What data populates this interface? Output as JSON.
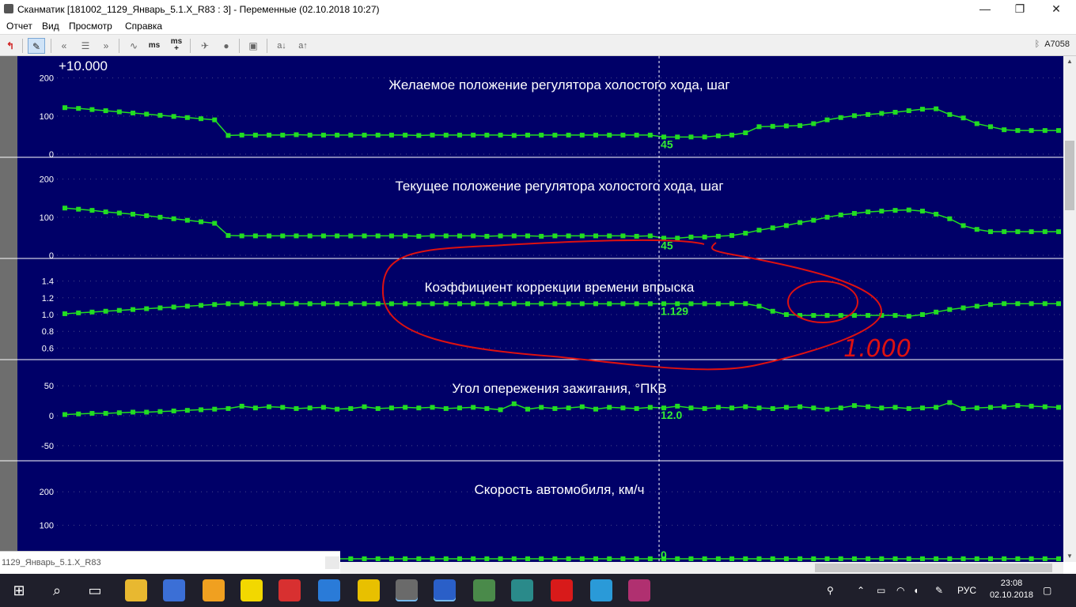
{
  "window": {
    "title": "Сканматик [181002_1129_Январь_5.1.X_R83 : 3] - Переменные (02.10.2018  10:27)",
    "minimize_glyph": "—",
    "maximize_glyph": "❐",
    "close_glyph": "✕"
  },
  "menu": {
    "items": [
      {
        "label": "Отчет"
      },
      {
        "label": "Вид"
      },
      {
        "label": "Просмотр"
      },
      {
        "label": "Справка"
      }
    ]
  },
  "toolbar": {
    "icons": [
      "exit-icon",
      "edit-icon",
      "prev-icon",
      "list-icon",
      "next-icon",
      "wave-icon",
      "ms-icon",
      "ms-plus-icon",
      "plane-icon",
      "record-icon",
      "save-icon",
      "a-down-icon",
      "a-up-icon"
    ],
    "ms_label": "ms",
    "ms_plus_label": "ms\n+",
    "a_down_label": "a↓",
    "a_up_label": "a↑",
    "device": "A7058",
    "bluetooth_icon": "bluetooth-icon"
  },
  "plot": {
    "background": "#000068",
    "line_color": "#22dd22",
    "scale_factor": "+10.000",
    "cursor_x_index": 44,
    "panels": [
      {
        "title": "Желаемое положение регулятора холостого хода, шаг",
        "ticks": [
          "200",
          "100",
          "0"
        ],
        "tick_values": [
          200,
          100,
          0
        ],
        "range": [
          0,
          220
        ],
        "cursor_value": "45",
        "values": [
          122,
          120,
          117,
          114,
          111,
          108,
          105,
          102,
          99,
          96,
          93,
          90,
          49,
          50,
          50,
          50,
          50,
          51,
          50,
          50,
          50,
          50,
          50,
          50,
          50,
          50,
          49,
          50,
          50,
          50,
          50,
          50,
          50,
          49,
          50,
          50,
          50,
          50,
          50,
          50,
          50,
          50,
          50,
          50,
          45,
          45,
          45,
          45,
          48,
          50,
          56,
          72,
          73,
          74,
          75,
          80,
          90,
          96,
          101,
          104,
          107,
          110,
          114,
          118,
          119,
          104,
          95,
          80,
          72,
          64,
          62,
          62,
          62,
          62
        ]
      },
      {
        "title": "Текущее положение регулятора холостого хода, шаг",
        "ticks": [
          "200",
          "100",
          "0"
        ],
        "tick_values": [
          200,
          100,
          0
        ],
        "range": [
          0,
          220
        ],
        "cursor_value": "45",
        "values": [
          124,
          121,
          118,
          114,
          111,
          108,
          104,
          100,
          96,
          92,
          88,
          84,
          52,
          51,
          51,
          51,
          51,
          51,
          51,
          51,
          51,
          51,
          51,
          51,
          51,
          51,
          50,
          51,
          51,
          51,
          51,
          50,
          51,
          51,
          51,
          50,
          51,
          51,
          51,
          51,
          51,
          51,
          50,
          51,
          45,
          45,
          48,
          48,
          50,
          52,
          58,
          66,
          72,
          78,
          86,
          92,
          100,
          106,
          110,
          114,
          116,
          118,
          119,
          116,
          108,
          96,
          78,
          68,
          62,
          62,
          62,
          62,
          62,
          62
        ]
      },
      {
        "title": "Коэффициент коррекции времени впрыска",
        "ticks": [
          "1.4",
          "1.2",
          "1.0",
          "0.8",
          "0.6"
        ],
        "tick_values": [
          1.4,
          1.2,
          1.0,
          0.8,
          0.6
        ],
        "range": [
          0.5,
          1.5
        ],
        "cursor_value": "1.129",
        "values": [
          1.01,
          1.02,
          1.03,
          1.04,
          1.05,
          1.06,
          1.07,
          1.08,
          1.09,
          1.1,
          1.11,
          1.12,
          1.129,
          1.129,
          1.129,
          1.129,
          1.129,
          1.129,
          1.129,
          1.129,
          1.129,
          1.129,
          1.129,
          1.129,
          1.129,
          1.129,
          1.129,
          1.129,
          1.129,
          1.129,
          1.129,
          1.129,
          1.129,
          1.129,
          1.129,
          1.129,
          1.129,
          1.129,
          1.129,
          1.129,
          1.129,
          1.129,
          1.129,
          1.129,
          1.129,
          1.129,
          1.129,
          1.129,
          1.129,
          1.13,
          1.13,
          1.1,
          1.04,
          1.0,
          0.99,
          0.99,
          0.99,
          0.99,
          0.99,
          0.99,
          0.99,
          0.99,
          0.98,
          1.0,
          1.03,
          1.06,
          1.08,
          1.1,
          1.12,
          1.13,
          1.13,
          1.13,
          1.13,
          1.13
        ]
      },
      {
        "title": "Угол опережения зажигания, °ПКВ",
        "ticks": [
          "50",
          "0",
          "-50"
        ],
        "tick_values": [
          50,
          0,
          -50
        ],
        "range": [
          -70,
          70
        ],
        "cursor_value": "12.0",
        "values": [
          2,
          3,
          4,
          4,
          5,
          6,
          6,
          7,
          8,
          9,
          10,
          11,
          12,
          16,
          13,
          15,
          14,
          12,
          13,
          14,
          11,
          12,
          15,
          12,
          13,
          14,
          13,
          14,
          12,
          13,
          14,
          12,
          10,
          20,
          11,
          14,
          12,
          13,
          15,
          11,
          14,
          13,
          12,
          14,
          13,
          16,
          13,
          12,
          14,
          13,
          15,
          13,
          12,
          14,
          15,
          13,
          11,
          13,
          17,
          15,
          13,
          14,
          12,
          13,
          14,
          22,
          12,
          13,
          14,
          15,
          17,
          16,
          15,
          14
        ]
      },
      {
        "title": "Скорость автомобиля, км/ч",
        "ticks": [
          "200",
          "100"
        ],
        "tick_values": [
          200,
          100
        ],
        "range": [
          0,
          250
        ],
        "cursor_value": "0",
        "values": [
          0,
          0,
          0,
          0,
          0,
          0,
          0,
          0,
          0,
          0,
          0,
          0,
          0,
          0,
          0,
          0,
          0,
          0,
          0,
          0,
          0,
          0,
          0,
          0,
          0,
          0,
          0,
          0,
          0,
          0,
          0,
          0,
          0,
          0,
          0,
          0,
          0,
          0,
          0,
          0,
          0,
          0,
          0,
          0,
          0,
          0,
          0,
          0,
          0,
          0,
          0,
          0,
          0,
          0,
          0,
          0,
          0,
          0,
          0,
          0,
          0,
          0,
          0,
          0,
          0,
          0,
          0,
          0,
          0,
          0,
          0,
          0,
          0,
          0
        ]
      }
    ],
    "annotation": {
      "handwritten_text": "1.000",
      "color": "#dd1111"
    }
  },
  "status": {
    "file_label": "1129_Январь_5.1.X_R83"
  },
  "taskbar": {
    "icons": [
      "windows-start-icon",
      "search-icon",
      "task-view-icon",
      "file-explorer-icon",
      "globe-app-icon",
      "car-app-icon",
      "plus-app-icon",
      "vasya-diagnost-icon",
      "teamviewer-icon",
      "gp-com-rus-icon",
      "scanmatik-icon",
      "oscilloscope-icon",
      "mechanic-app-icon",
      "scope-app-icon",
      "opera-icon",
      "window-app-icon",
      "winrar-icon"
    ],
    "language": "РУС",
    "time": "23:08",
    "date": "02.10.2018"
  }
}
